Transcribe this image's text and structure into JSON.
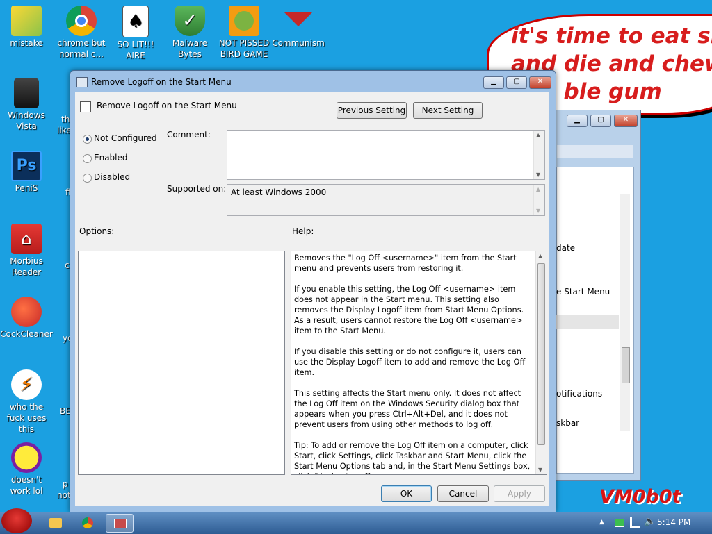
{
  "desktop": {
    "icons": [
      {
        "label": "mistake"
      },
      {
        "label": "chrome but normal c..."
      },
      {
        "label": "SO LIT!!! AIRE"
      },
      {
        "label": "Malware Bytes"
      },
      {
        "label": "NOT PISSED BIRD GAME"
      },
      {
        "label": "Communism"
      },
      {
        "label": "Windows Vista"
      },
      {
        "label": "PeniS"
      },
      {
        "label": "Morbius Reader"
      },
      {
        "label": "CockCleaner"
      },
      {
        "label": "who the fuck uses this"
      },
      {
        "label": "doesn't work lol"
      }
    ],
    "partial_labels": [
      "th",
      "like",
      "fi",
      "c",
      "yo",
      "BE",
      "p",
      "not"
    ],
    "speech_bubble": "it's time to eat shit\nand die and chew\n       ble gum",
    "watermark": "VM0b0t"
  },
  "background_window": {
    "items": [
      "date",
      "e Start Menu",
      "otifications",
      "skbar"
    ]
  },
  "dialog": {
    "title": "Remove Logoff on the Start Menu",
    "setting_name": "Remove Logoff on the Start Menu",
    "previous_button": "Previous Setting",
    "next_button": "Next Setting",
    "radio_not_configured": "Not Configured",
    "radio_enabled": "Enabled",
    "radio_disabled": "Disabled",
    "selected_option": "Not Configured",
    "comment_label": "Comment:",
    "comment_value": "",
    "supported_label": "Supported on:",
    "supported_value": "At least Windows 2000",
    "options_label": "Options:",
    "help_label": "Help:",
    "help_paragraphs": [
      "Removes the \"Log Off <username>\" item from the Start menu and prevents users from restoring it.",
      "If you enable this setting, the Log Off <username> item does not appear in the Start menu. This setting also removes the Display Logoff item from Start Menu Options. As a result, users cannot restore the Log Off <username> item to the Start Menu.",
      "If you disable this setting or do not configure it, users can use the Display Logoff item to add and remove the Log Off item.",
      "This setting affects the Start menu only. It does not affect the Log Off item on the Windows Security dialog box that appears when you press Ctrl+Alt+Del, and it does not prevent users from using other methods to log off.",
      "Tip: To add or remove the Log Off item on a computer, click Start, click Settings, click Taskbar and Start Menu, click the Start Menu Options tab and, in the Start Menu Settings box, click Display Logoff."
    ],
    "ok_button": "OK",
    "cancel_button": "Cancel",
    "apply_button": "Apply"
  },
  "taskbar": {
    "clock": "5:14 PM"
  },
  "colors": {
    "desktop": "#1ba0e1",
    "dialog_frame": "#9fc1e6",
    "bubble_text": "#d71d1d"
  }
}
